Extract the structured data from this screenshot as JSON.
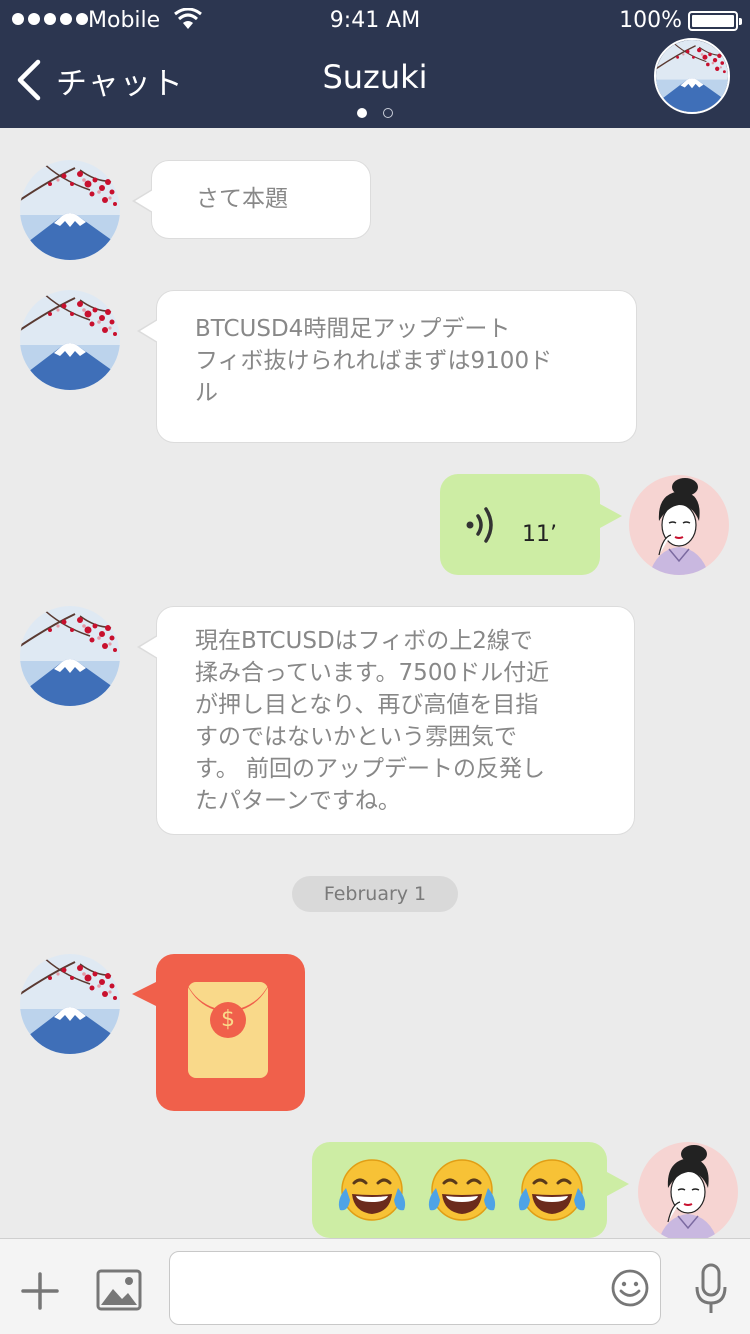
{
  "status_bar": {
    "carrier": "Mobile",
    "time": "9:41 AM",
    "battery": "100%"
  },
  "nav": {
    "back_label": "チャット",
    "title": "Suzuki"
  },
  "messages": [
    {
      "sender": "Suzuki",
      "type": "text",
      "lines": [
        "さて本題"
      ]
    },
    {
      "sender": "Suzuki",
      "type": "text",
      "lines": [
        "BTCUSD4時間足アップデート",
        "フィボ抜けられればまずは9100ド",
        "ル"
      ]
    },
    {
      "sender": "me",
      "type": "voice",
      "duration": "11’"
    },
    {
      "sender": "Suzuki",
      "type": "text",
      "lines": [
        "現在BTCUSDはフィボの上2線で",
        "揉み合っています。7500ドル付近",
        "が押し目となり、再び高値を目指",
        "すのではないかという雰囲気で",
        "す。 前回のアップデートの反発し",
        "たパターンですね。"
      ]
    },
    {
      "sender": "Suzuki",
      "type": "red-envelope",
      "symbol": "$"
    },
    {
      "sender": "me",
      "type": "emoji",
      "emoji": [
        "😂",
        "😂",
        "😂"
      ]
    }
  ],
  "date_separator": "February 1",
  "input": {
    "placeholder": ""
  },
  "colors": {
    "nav_bg": "#2c3650",
    "chat_bg": "#ebebeb",
    "outgoing_bubble": "#cdeda4",
    "red_envelope": "#f0604b",
    "envelope_paper": "#f9d98a"
  }
}
